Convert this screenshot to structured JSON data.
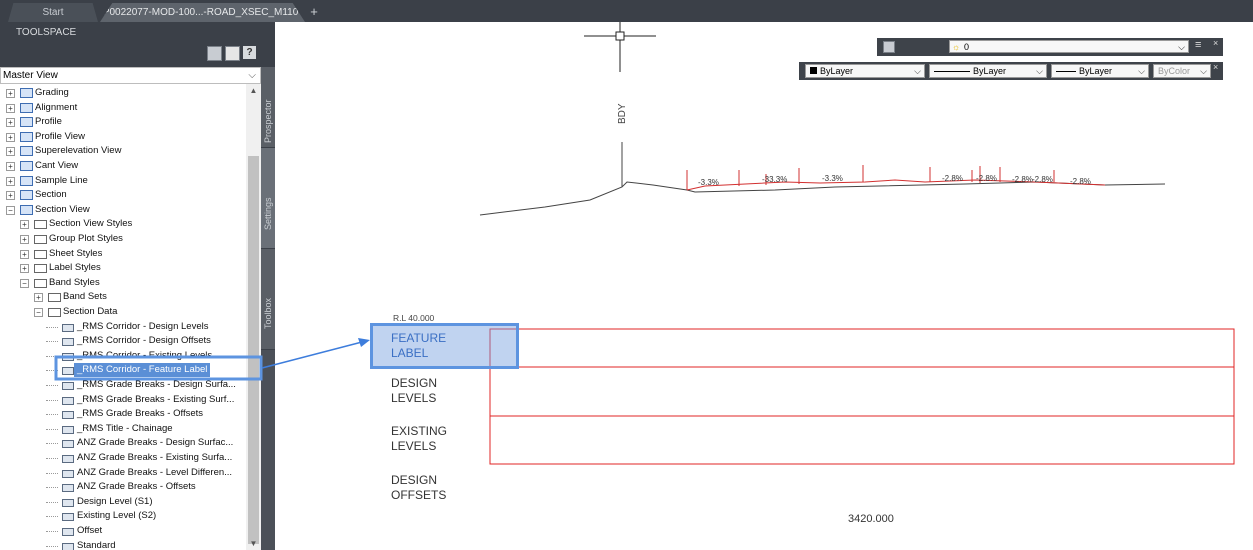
{
  "tabs": [
    {
      "label": "Start"
    },
    {
      "label": "P0022077-MOD-100...-ROAD_XSEC_M110*",
      "close": "×"
    }
  ],
  "tab_add": "+",
  "toolspace": {
    "title": "TOOLSPACE",
    "help": "?",
    "master_view": "Master View",
    "side_tabs": [
      "Prospector",
      "Settings",
      "Toolbox"
    ],
    "tree": [
      {
        "label": "Grading",
        "level": 1,
        "exp": "+",
        "icon": "grading-icon"
      },
      {
        "label": "Alignment",
        "level": 1,
        "exp": "+",
        "icon": "alignment-icon"
      },
      {
        "label": "Profile",
        "level": 1,
        "exp": "+",
        "icon": "profile-icon"
      },
      {
        "label": "Profile View",
        "level": 1,
        "exp": "+",
        "icon": "profile-view-icon"
      },
      {
        "label": "Superelevation View",
        "level": 1,
        "exp": "+",
        "icon": "superelevation-icon"
      },
      {
        "label": "Cant View",
        "level": 1,
        "exp": "+",
        "icon": "cant-view-icon"
      },
      {
        "label": "Sample Line",
        "level": 1,
        "exp": "+",
        "icon": "sample-line-icon"
      },
      {
        "label": "Section",
        "level": 1,
        "exp": "+",
        "icon": "section-icon"
      },
      {
        "label": "Section View",
        "level": 1,
        "exp": "−",
        "icon": "section-view-icon"
      },
      {
        "label": "Section View Styles",
        "level": 2,
        "exp": "+",
        "icon": "folder-icon"
      },
      {
        "label": "Group Plot Styles",
        "level": 2,
        "exp": "+",
        "icon": "folder-icon"
      },
      {
        "label": "Sheet Styles",
        "level": 2,
        "exp": "+",
        "icon": "folder-icon"
      },
      {
        "label": "Label Styles",
        "level": 2,
        "exp": "+",
        "icon": "folder-icon"
      },
      {
        "label": "Band Styles",
        "level": 2,
        "exp": "−",
        "icon": "folder-icon"
      },
      {
        "label": "Band Sets",
        "level": 3,
        "exp": "+",
        "icon": "folder-icon"
      },
      {
        "label": "Section Data",
        "level": 3,
        "exp": "−",
        "icon": "folder-icon"
      },
      {
        "label": "_RMS Corridor - Design Levels",
        "level": 4,
        "icon": "band-style-icon"
      },
      {
        "label": "_RMS Corridor - Design Offsets",
        "level": 4,
        "icon": "band-style-icon"
      },
      {
        "label": "_RMS Corridor - Existing Levels",
        "level": 4,
        "icon": "band-style-icon"
      },
      {
        "label": "_RMS Corridor - Feature Label",
        "level": 4,
        "icon": "band-style-icon",
        "selected": true
      },
      {
        "label": "_RMS Grade Breaks - Design Surfa...",
        "level": 4,
        "icon": "band-style-icon"
      },
      {
        "label": "_RMS Grade Breaks - Existing Surf...",
        "level": 4,
        "icon": "band-style-icon"
      },
      {
        "label": "_RMS Grade Breaks - Offsets",
        "level": 4,
        "icon": "band-style-icon"
      },
      {
        "label": "_RMS Title - Chainage",
        "level": 4,
        "icon": "band-style-icon"
      },
      {
        "label": "ANZ Grade Breaks - Design Surfac...",
        "level": 4,
        "icon": "band-style-icon"
      },
      {
        "label": "ANZ Grade Breaks - Existing Surfa...",
        "level": 4,
        "icon": "band-style-icon"
      },
      {
        "label": "ANZ Grade Breaks - Level Differen...",
        "level": 4,
        "icon": "band-style-icon"
      },
      {
        "label": "ANZ Grade Breaks - Offsets",
        "level": 4,
        "icon": "band-style-icon"
      },
      {
        "label": "Design Level (S1)",
        "level": 4,
        "icon": "band-style-icon"
      },
      {
        "label": "Existing Level (S2)",
        "level": 4,
        "icon": "band-style-icon"
      },
      {
        "label": "Offset",
        "level": 4,
        "icon": "band-style-icon"
      },
      {
        "label": "Standard",
        "level": 4,
        "icon": "band-style-plain-icon"
      }
    ]
  },
  "toolbar": {
    "layer": "0",
    "color": "ByLayer",
    "linetype": "ByLayer",
    "lineweight": "ByLayer",
    "plotstyle": "ByColor",
    "close": "×"
  },
  "drawing": {
    "bdy_label": "BDY",
    "grades": [
      "-3.3%",
      "-3.3%",
      "-3.3%",
      "-2.8%",
      "-2.8%",
      "-2.8%",
      "-2.8%",
      "-2.8%"
    ],
    "grade_overlap": "-33.3%",
    "rl_label": "R.L 40.000",
    "bands": [
      "FEATURE\nLABEL",
      "DESIGN\nLEVELS",
      "EXISTING\nLEVELS",
      "DESIGN\nOFFSETS"
    ],
    "chainage": "3420.000",
    "colors": {
      "band_line": "#e02424",
      "highlight": "#5d94e0",
      "pavement": "#d23030"
    }
  }
}
